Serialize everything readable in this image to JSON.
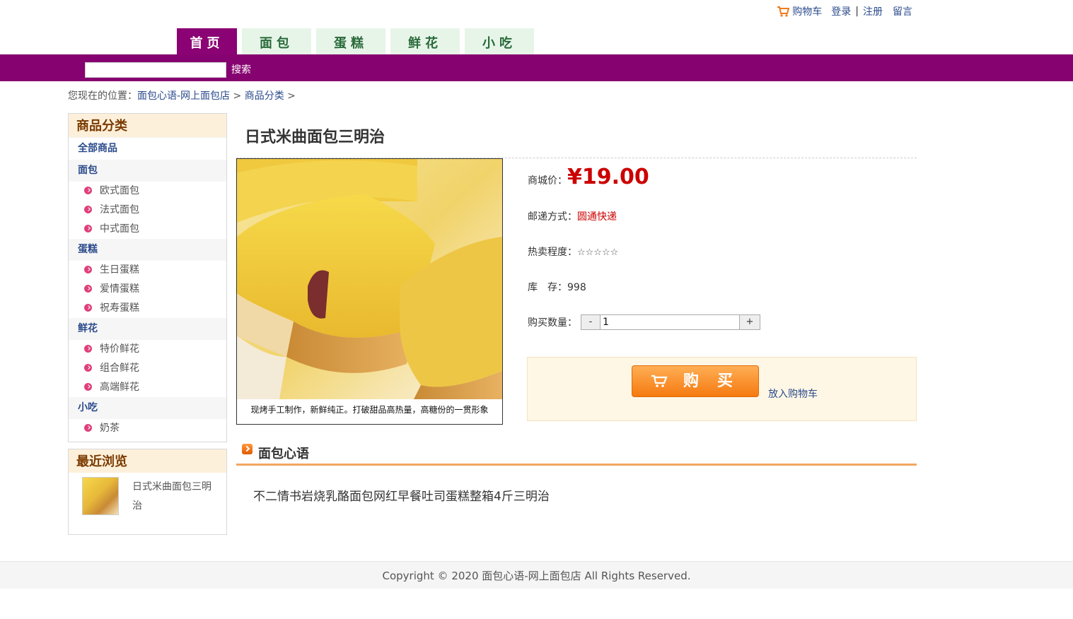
{
  "toplinks": {
    "cart": "购物车",
    "login": "登录",
    "sep": "|",
    "register": "注册",
    "message": "留言"
  },
  "nav": {
    "tabs": [
      "首页",
      "面包",
      "蛋糕",
      "鲜花",
      "小吃"
    ]
  },
  "search": {
    "button": "搜索",
    "placeholder": ""
  },
  "breadcrumb": {
    "prefix": "您现在的位置：",
    "home": "面包心语-网上面包店",
    "sep1": ">",
    "category": "商品分类",
    "sep2": ">"
  },
  "sidebar": {
    "title": "商品分类",
    "all": "全部商品",
    "groups": [
      {
        "name": "面包",
        "items": [
          "欧式面包",
          "法式面包",
          "中式面包"
        ]
      },
      {
        "name": "蛋糕",
        "items": [
          "生日蛋糕",
          "爱情蛋糕",
          "祝寿蛋糕"
        ]
      },
      {
        "name": "鲜花",
        "items": [
          "特价鲜花",
          "组合鲜花",
          "高端鲜花"
        ]
      },
      {
        "name": "小吃",
        "items": [
          "奶茶"
        ]
      }
    ]
  },
  "recent": {
    "title": "最近浏览",
    "item_name": "日式米曲面包三明治"
  },
  "product": {
    "title": "日式米曲面包三明治",
    "caption": "现烤手工制作，新鲜纯正。打破甜品高热量，高糖份的一贯形象",
    "price_label": "商城价：",
    "price": "¥19.00",
    "shipping_label": "邮递方式：",
    "shipping": "圆通快递",
    "hot_label": "热卖程度：",
    "stars": "☆☆☆☆☆",
    "stock_label": "库　存：",
    "stock": "998",
    "qty_label": "购买数量：",
    "minus": "-",
    "qty": "1",
    "plus": "+",
    "buy_button": "购买",
    "add_to_cart": "放入购物车"
  },
  "section": {
    "title": "面包心语",
    "body": "不二情书岩烧乳酪面包网红早餐吐司蛋糕整箱4斤三明治"
  },
  "footer": {
    "text": "Copyright © 2020 面包心语-网上面包店 All Rights Reserved."
  },
  "colors": {
    "purple": "#860270",
    "price_red": "#cc0000",
    "tab_green_bg": "#e7f5e9",
    "buy_orange": "#f57a10"
  }
}
